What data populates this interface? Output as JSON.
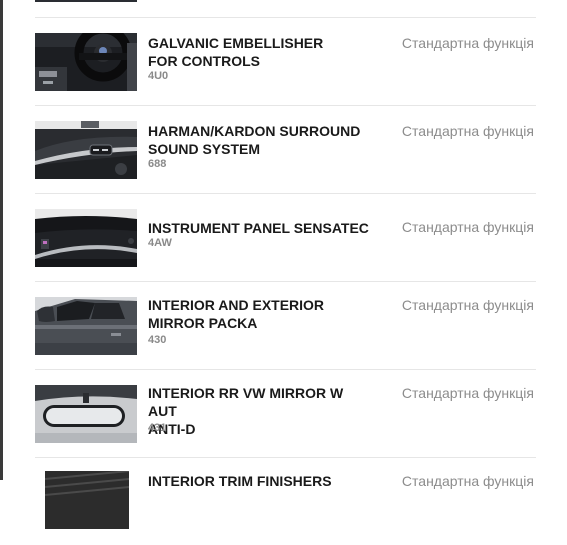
{
  "options": [
    {
      "title": "GALVANIC EMBELLISHER\nFOR CONTROLS",
      "code": "4U0",
      "status": "Стандартна функція",
      "image": "steering-wheel-image"
    },
    {
      "title": "HARMAN/KARDON SURROUND\nSOUND SYSTEM",
      "code": "688",
      "status": "Стандартна функція",
      "image": "door-speaker-image"
    },
    {
      "title": "INSTRUMENT PANEL SENSATEC",
      "code": "4AW",
      "status": "Стандартна функція",
      "image": "dashboard-image"
    },
    {
      "title": "INTERIOR AND EXTERIOR\nMIRROR PACKA",
      "code": "430",
      "status": "Стандартна функція",
      "image": "side-mirror-image"
    },
    {
      "title": "INTERIOR RR VW MIRROR W AUT\nANTI-D",
      "code": "431",
      "status": "Стандартна функція",
      "image": "rearview-mirror-image"
    },
    {
      "title": "INTERIOR TRIM FINISHERS",
      "code": "",
      "status": "Стандартна функція",
      "image": "trim-finisher-image"
    }
  ]
}
